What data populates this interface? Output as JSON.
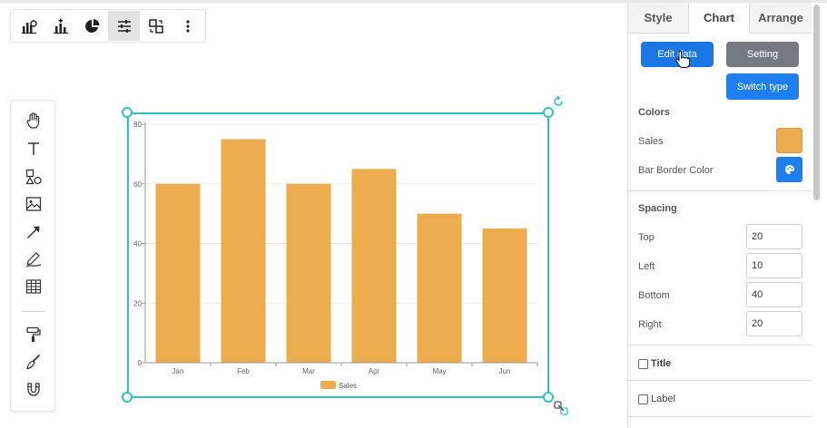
{
  "panel": {
    "tabs": [
      {
        "label": "Style",
        "active": false
      },
      {
        "label": "Chart",
        "active": true
      },
      {
        "label": "Arrange",
        "active": false
      }
    ],
    "buttons": {
      "edit_data": "Edit data",
      "setting": "Setting",
      "switch_type": "Switch type"
    },
    "colors": {
      "title": "Colors",
      "sales_label": "Sales",
      "sales_color": "#ecab4c",
      "border_label": "Bar Border Color",
      "border_color": "#1e7ff0"
    },
    "spacing": {
      "title": "Spacing",
      "top_label": "Top",
      "top_value": "20",
      "left_label": "Left",
      "left_value": "10",
      "bottom_label": "Bottom",
      "bottom_value": "40",
      "right_label": "Right",
      "right_value": "20"
    },
    "title_checkbox": {
      "label": "Title",
      "checked": false
    },
    "label_checkbox": {
      "label": "Label",
      "checked": false
    }
  },
  "chart_toolbar": {
    "icons": [
      "bar-chart-icon",
      "bar-chart-add-icon",
      "pie-chart-icon",
      "sliders-icon",
      "swap-icon",
      "more-vertical-icon"
    ],
    "active": "sliders-icon"
  },
  "tool_palette": {
    "icons": [
      "hand-icon",
      "text-icon",
      "shapes-icon",
      "image-icon",
      "arrow-icon",
      "pen-icon",
      "table-icon",
      "paint-roller-icon",
      "brush-icon",
      "magnet-icon"
    ]
  },
  "accent_color": "#2ec4bd",
  "chart_data": {
    "type": "bar",
    "categories": [
      "Jan",
      "Feb",
      "Mar",
      "Apr",
      "May",
      "Jun"
    ],
    "series": [
      {
        "name": "Sales",
        "values": [
          60,
          75,
          60,
          65,
          50,
          45
        ],
        "color": "#ecab4c"
      }
    ],
    "yticks": [
      "0",
      "20",
      "40",
      "60",
      "80"
    ],
    "ylim": [
      0,
      80
    ],
    "legend": "bottom",
    "grid": true,
    "title": "",
    "xlabel": "",
    "ylabel": ""
  }
}
